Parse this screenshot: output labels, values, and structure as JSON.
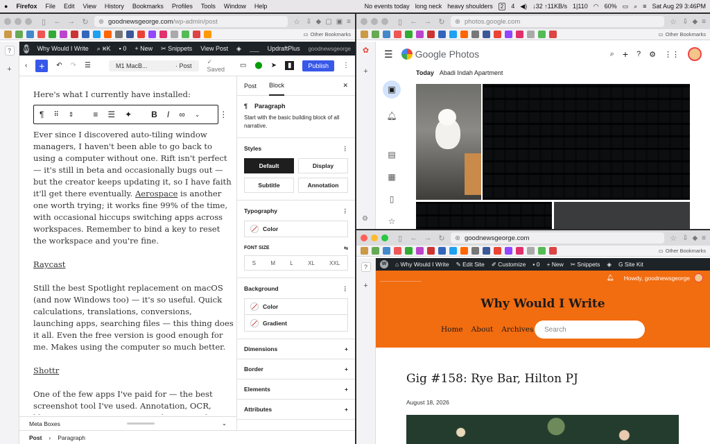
{
  "menubar": {
    "app": "Firefox",
    "menus": [
      "File",
      "Edit",
      "View",
      "History",
      "Bookmarks",
      "Profiles",
      "Tools",
      "Window",
      "Help"
    ],
    "status": [
      "No events today",
      "long neck",
      "heavy shoulders"
    ],
    "desk1": "2",
    "desk2": "4",
    "net": "↓32 ↑11KB/s",
    "cpu": "1|110",
    "battery": "60%",
    "datetime": "Sat Aug 29  3:46PM"
  },
  "wp": {
    "url_host": "goodnewsgeorge.com",
    "url_path": "/wp-admin/post",
    "admin_site": "Why Would I Write",
    "admin_k": "⌘K",
    "admin_comments": "0",
    "admin_new": "New",
    "admin_snippets": "Snippets",
    "admin_view": "View Post",
    "admin_updraft": "UpdraftPlus",
    "admin_howdy": "goodnewsgeorge",
    "doc_title": "M1 MacB...",
    "doc_type": "· Post",
    "saved": "Saved",
    "publish": "Publish",
    "intro": "Here's what I currently have installed:",
    "para1_a": "Ever since I discovered auto-tiling window managers, I haven't been able to go back to using a computer without one. Rift isn't perfect — it's still in beta and occasionally bugs out — but the creator keeps updating it, so I have faith it'll get there eventually. ",
    "para1_link": "Aerospace",
    "para1_b": " is another one worth trying; it works fine 99% of the time, with occasional hiccups switching apps across workspaces. Remember to bind a key to reset the workspace and you're fine.",
    "h_raycast": "Raycast",
    "para2": "Still the best Spotlight replacement on macOS (and now Windows too) — it's so useful. Quick calculations, translations, conversions, launching apps, searching files — this thing does it all. Even the free version is good enough for me. Makes using the computer so much better.",
    "h_shottr": "Shottr",
    "para3": "One of the few apps I've paid for — the best screenshot tool I've used. Annotation, OCR, blurring, erasing, cropping, and more, and it's faster than the default macOS screenshot tool.",
    "meta_boxes": "Meta Boxes",
    "crumb_post": "Post",
    "crumb_block": "Paragraph",
    "inspector": {
      "tab_post": "Post",
      "tab_block": "Block",
      "block_name": "Paragraph",
      "block_desc": "Start with the basic building block of all narrative.",
      "styles_title": "Styles",
      "styles": [
        "Default",
        "Display",
        "Subtitle",
        "Annotation"
      ],
      "typography_title": "Typography",
      "color_label": "Color",
      "font_size_label": "FONT SIZE",
      "font_sizes": [
        "S",
        "M",
        "L",
        "XL",
        "XXL"
      ],
      "background_title": "Background",
      "bg_color": "Color",
      "bg_gradient": "Gradient",
      "dimensions": "Dimensions",
      "border": "Border",
      "elements": "Elements",
      "attributes": "Attributes"
    }
  },
  "photos": {
    "url": "photos.google.com",
    "logo_text": "Google Photos",
    "date": "Today",
    "location": "Abadi Indah Apartment"
  },
  "blog": {
    "url": "goodnewsgeorge.com",
    "admin_site": "Why Would I Write",
    "admin_edit": "Edit Site",
    "admin_customize": "Customize",
    "admin_comments": "0",
    "admin_new": "New",
    "admin_snippets": "Snippets",
    "admin_sitekit": "Site Kit",
    "howdy": "Howdy, goodnewsgeorge",
    "site_title": "Why Would I Write",
    "nav": [
      "Home",
      "About",
      "Archives"
    ],
    "search_placeholder": "Search",
    "post_title": "Gig #158: Rye Bar, Hilton PJ",
    "post_date": "August 18, 2026"
  },
  "bookmarks_folder": "Other Bookmarks",
  "colors": {
    "wp_blue": "#3858e9",
    "admin_dark": "#1d2327",
    "blog_orange": "#f26c10"
  }
}
